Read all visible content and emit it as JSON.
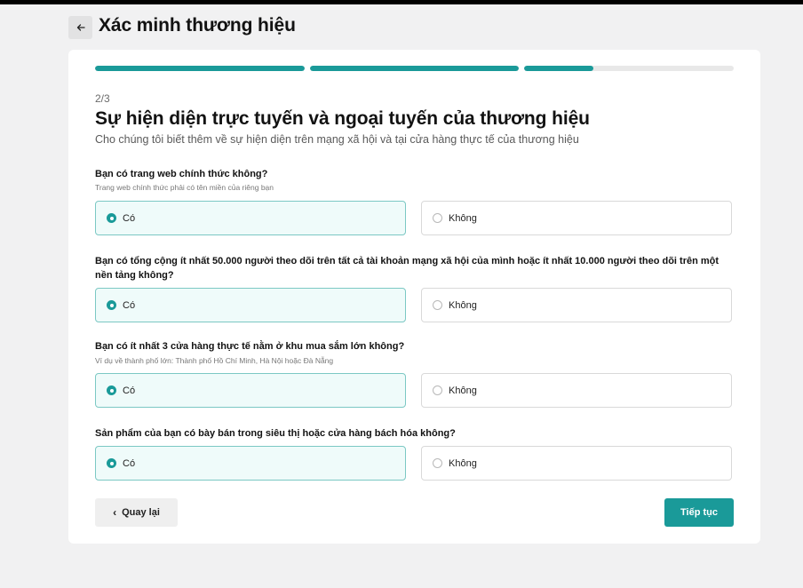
{
  "header": {
    "title": "Xác minh thương hiệu"
  },
  "progress": {
    "segments": [
      1.0,
      1.0,
      0.33
    ]
  },
  "form": {
    "step": "2/3",
    "heading": "Sự hiện diện trực tuyến và ngoại tuyến của thương hiệu",
    "subheading": "Cho chúng tôi biết thêm về sự hiện diện trên mạng xã hội và tại cửa hàng thực tế của thương hiệu",
    "questions": [
      {
        "text": "Bạn có trang web chính thức không?",
        "hint": "Trang web chính thức phải có tên miền của riêng bạn",
        "yes": "Có",
        "no": "Không",
        "selected": "yes"
      },
      {
        "text": "Bạn có tổng cộng ít nhất 50.000 người theo dõi trên tất cả tài khoản mạng xã hội của mình hoặc ít nhất 10.000 người theo dõi trên một nền tảng không?",
        "hint": "",
        "yes": "Có",
        "no": "Không",
        "selected": "yes"
      },
      {
        "text": "Bạn có ít nhất 3 cửa hàng thực tế nằm ở khu mua sắm lớn không?",
        "hint": "Ví dụ về thành phố lớn: Thành phố Hồ Chí Minh, Hà Nội hoặc Đà Nẵng",
        "yes": "Có",
        "no": "Không",
        "selected": "yes"
      },
      {
        "text": "Sản phẩm của bạn có bày bán trong siêu thị hoặc cửa hàng bách hóa không?",
        "hint": "",
        "yes": "Có",
        "no": "Không",
        "selected": "yes"
      }
    ]
  },
  "footer": {
    "back_label": "Quay lại",
    "next_label": "Tiếp tục"
  },
  "colors": {
    "accent": "#1a9a99",
    "selected_bg": "#effbfa",
    "page_bg": "#f1f1f2"
  },
  "icons": {
    "back": "arrow-left-icon",
    "back_button_chevron": "chevron-left-icon"
  }
}
